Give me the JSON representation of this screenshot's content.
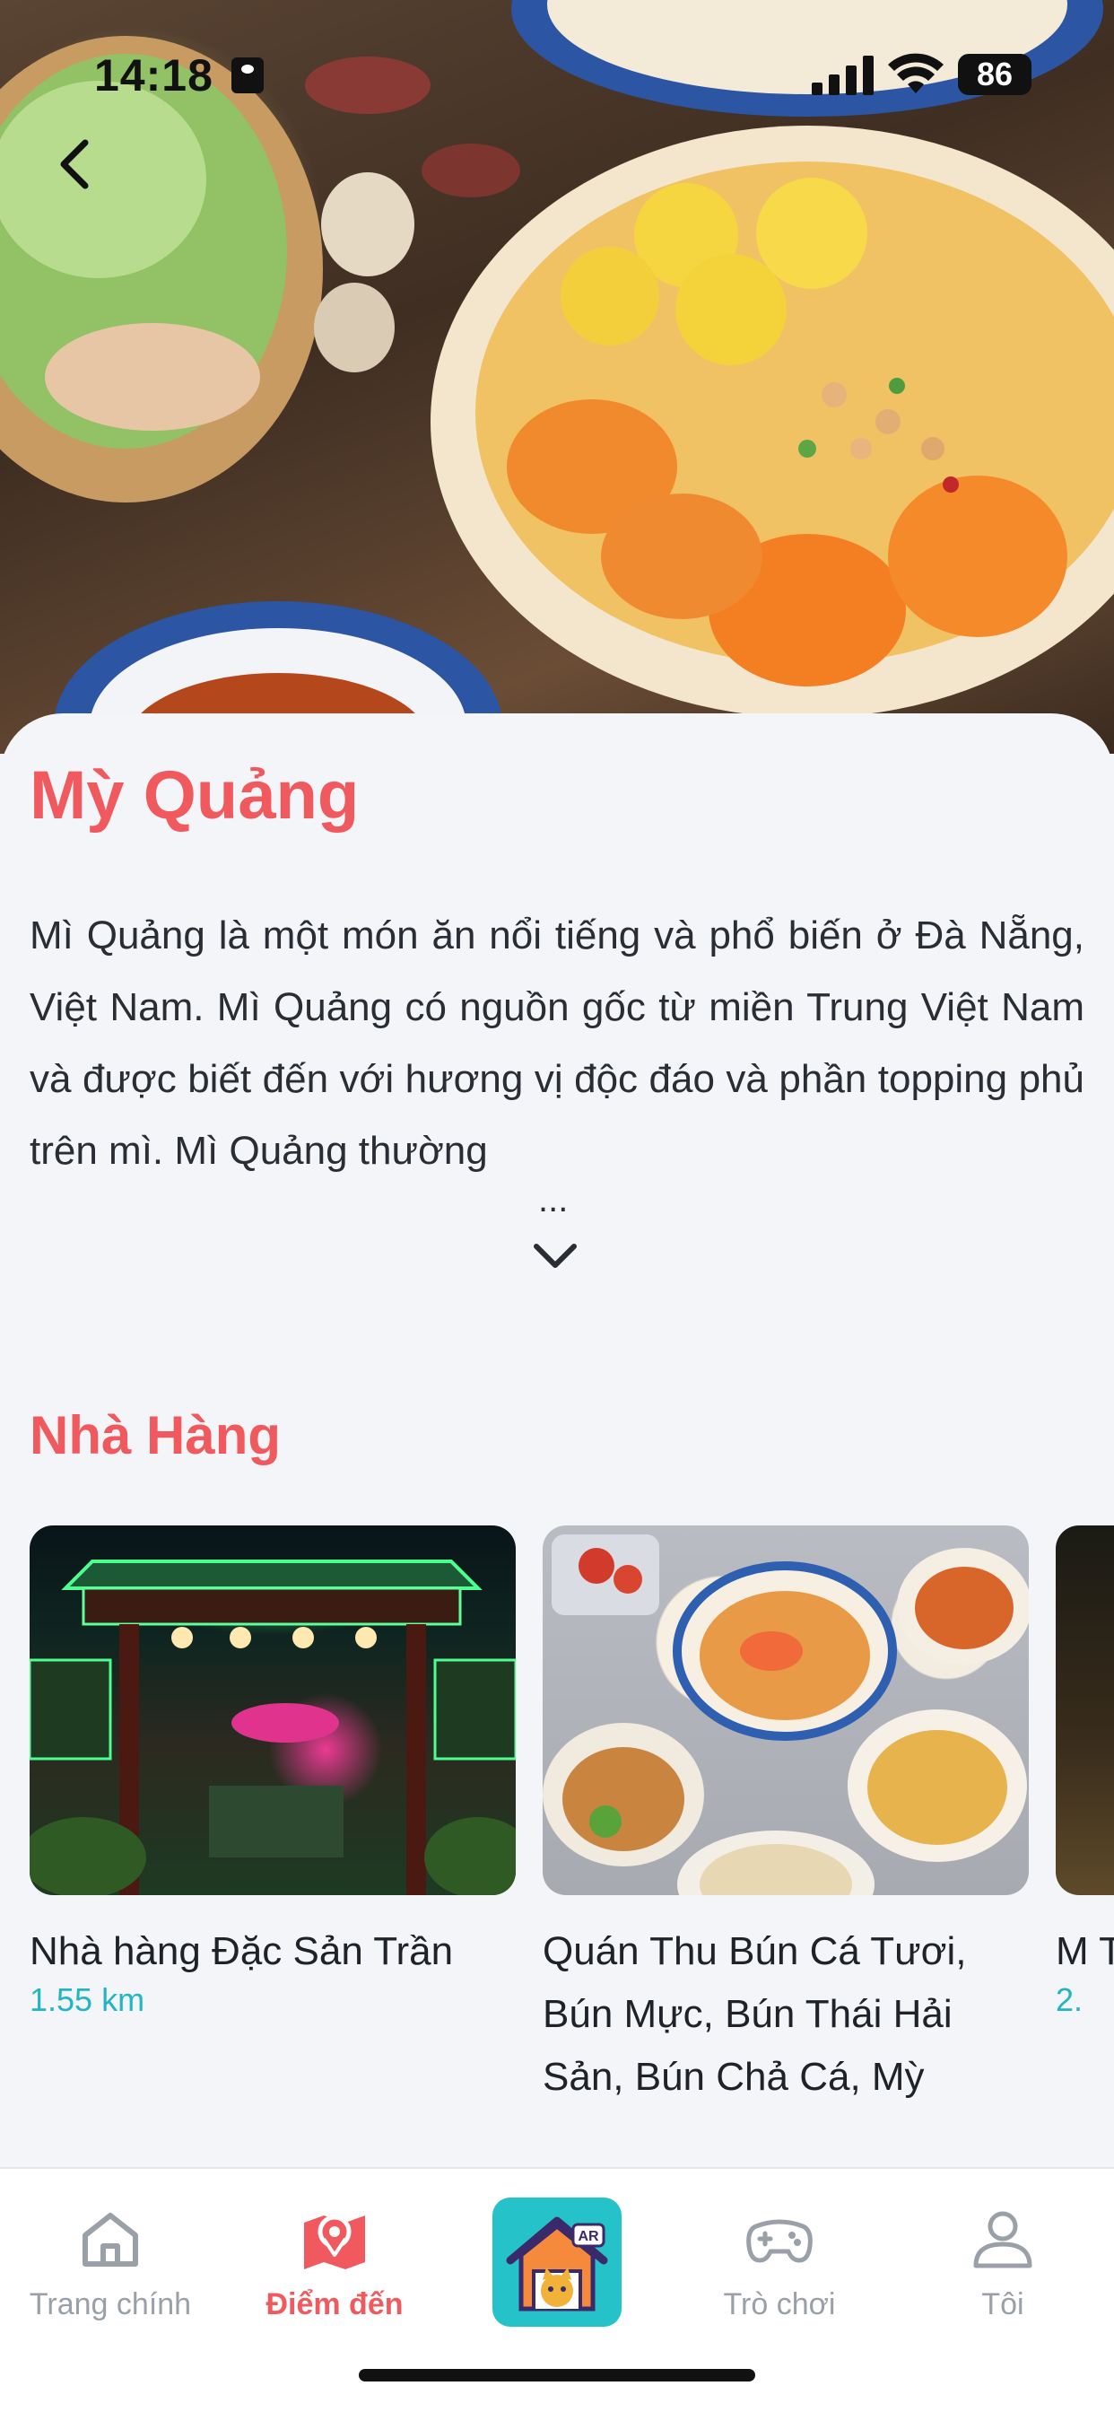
{
  "status_bar": {
    "time": "14:18",
    "battery": "86"
  },
  "dish": {
    "title": "Mỳ Quảng",
    "description": "Mì Quảng là một món ăn nổi tiếng và phổ biến ở Đà Nẵng, Việt Nam. Mì Quảng có nguồn gốc từ miền Trung Việt Nam và được biết đến với hương vị độc đáo và phần topping phủ trên mì. Mì Quảng thường",
    "ellipsis": "..."
  },
  "restaurants": {
    "section_title": "Nhà Hàng",
    "items": [
      {
        "name": "Nhà hàng Đặc Sản Trần",
        "distance": "1.55 km"
      },
      {
        "name": "Quán Thu Bún Cá Tươi, Bún Mực, Bún Thái Hải Sản, Bún Chả Cá, Mỳ",
        "distance": ""
      },
      {
        "name": "M T",
        "distance": "2."
      }
    ]
  },
  "tabbar": {
    "items": [
      {
        "label": "Trang chính",
        "icon": "home-icon"
      },
      {
        "label": "Điểm đến",
        "icon": "map-pin-icon"
      },
      {
        "label": "",
        "icon": "ar-cat-house-icon",
        "badge": "AR"
      },
      {
        "label": "Trò chơi",
        "icon": "gamepad-icon"
      },
      {
        "label": "Tôi",
        "icon": "user-icon"
      }
    ],
    "active_index": 1
  },
  "colors": {
    "accent": "#f05a5e",
    "link": "#23b5c3",
    "ar_bg": "#25c2c9"
  }
}
